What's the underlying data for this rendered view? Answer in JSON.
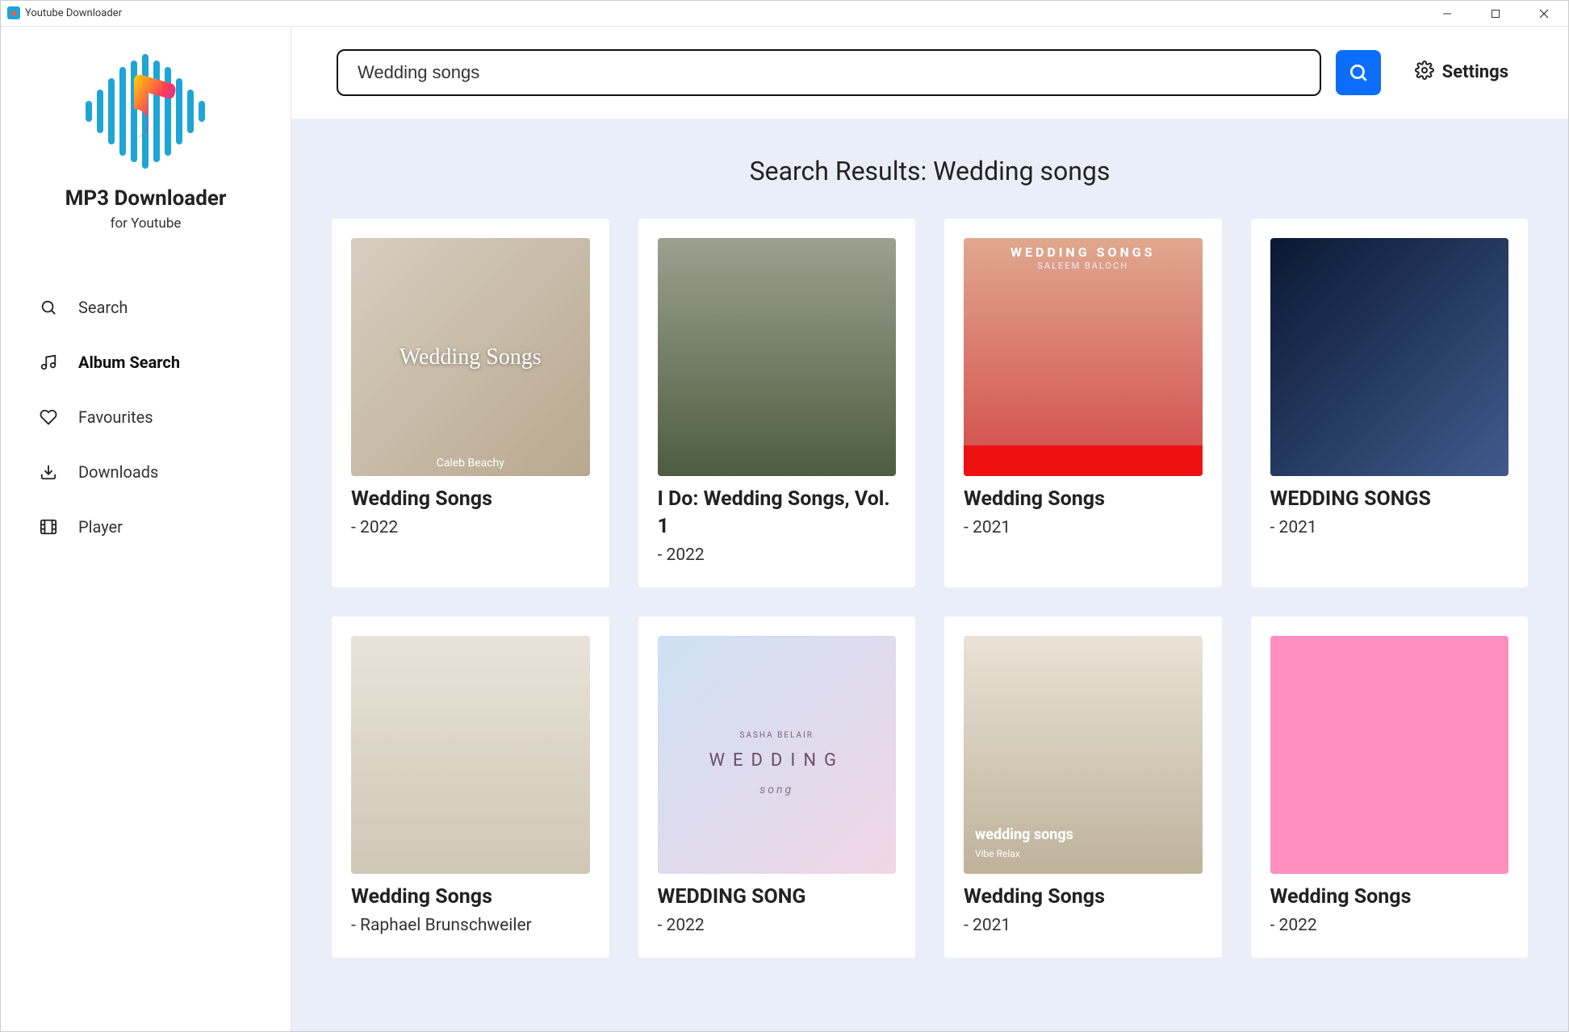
{
  "window": {
    "title": "Youtube Downloader"
  },
  "branding": {
    "name": "MP3 Downloader",
    "subtitle": "for Youtube"
  },
  "sidebar": {
    "items": [
      {
        "label": "Search",
        "icon": "search"
      },
      {
        "label": "Album Search",
        "icon": "music"
      },
      {
        "label": "Favourites",
        "icon": "heart"
      },
      {
        "label": "Downloads",
        "icon": "download"
      },
      {
        "label": "Player",
        "icon": "film"
      }
    ],
    "active_index": 1
  },
  "topbar": {
    "search_value": "Wedding songs",
    "search_placeholder": "Search",
    "settings_label": "Settings"
  },
  "results": {
    "heading": "Search Results: Wedding songs",
    "items": [
      {
        "title": "Wedding Songs",
        "meta": "- 2022",
        "thumb_overlay": "Wedding Songs",
        "thumb_artist": "Caleb Beachy"
      },
      {
        "title": "I Do: Wedding Songs, Vol. 1",
        "meta": "- 2022"
      },
      {
        "title": "Wedding Songs",
        "meta": "- 2021",
        "thumb_header": "WEDDING SONGS",
        "thumb_name": "SALEEM BALOCH"
      },
      {
        "title": "WEDDING SONGS",
        "meta": "- 2021"
      },
      {
        "title": "Wedding Songs",
        "meta": "- Raphael Brunschweiler"
      },
      {
        "title": "WEDDING SONG",
        "meta": "- 2022",
        "thumb_text": "WEDDING",
        "thumb_sub": "song",
        "thumb_small": "SASHA BELAIR"
      },
      {
        "title": "Wedding Songs",
        "meta": "- 2021",
        "thumb_ws": "wedding songs",
        "thumb_wr": "Vibe Relax"
      },
      {
        "title": "Wedding Songs",
        "meta": "- 2022"
      }
    ]
  }
}
